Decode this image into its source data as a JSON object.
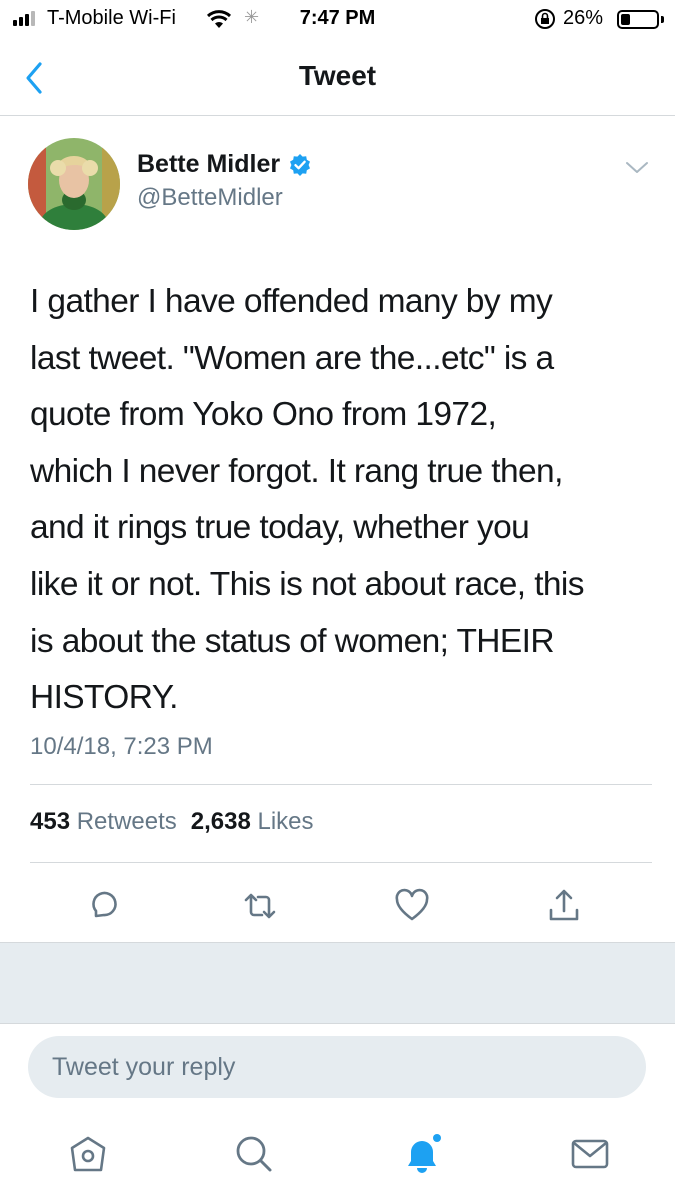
{
  "status_bar": {
    "carrier": "T-Mobile Wi-Fi",
    "time": "7:47 PM",
    "battery_percent": "26%",
    "battery_level": 0.26,
    "signal_icon": "signal-bars-icon",
    "wifi_icon": "wifi-icon",
    "activity_icon": "activity-spinner-icon",
    "lock_icon": "orientation-lock-icon"
  },
  "nav": {
    "title": "Tweet",
    "back_icon": "chevron-left-icon"
  },
  "tweet": {
    "author_name": "Bette Midler",
    "verified_icon": "verified-badge-icon",
    "handle": "@BetteMidler",
    "text": "I gather I have offended many by my\nlast tweet.  \"Women are the...etc\" is a\nquote from Yoko Ono from 1972,\nwhich I never forgot.  It rang true then,\nand it rings true today, whether you\nlike it or not. This is not about race, this\nis about the status of women; THEIR\nHISTORY.",
    "timestamp": "10/4/18, 7:23 PM",
    "retweets_count": "453",
    "retweets_label": "Retweets",
    "likes_count": "2,638",
    "likes_label": "Likes"
  },
  "actions": [
    "reply-icon",
    "retweet-icon",
    "like-icon",
    "share-icon"
  ],
  "reply_box": {
    "placeholder": "Tweet your reply"
  },
  "tab_bar": [
    "home-icon",
    "search-icon",
    "notifications-icon",
    "messages-icon"
  ],
  "colors": {
    "accent": "#1da1f2",
    "text": "#14171a",
    "secondary_text": "#657786",
    "divider": "#d5d9dc",
    "band": "#e6ecf0"
  }
}
